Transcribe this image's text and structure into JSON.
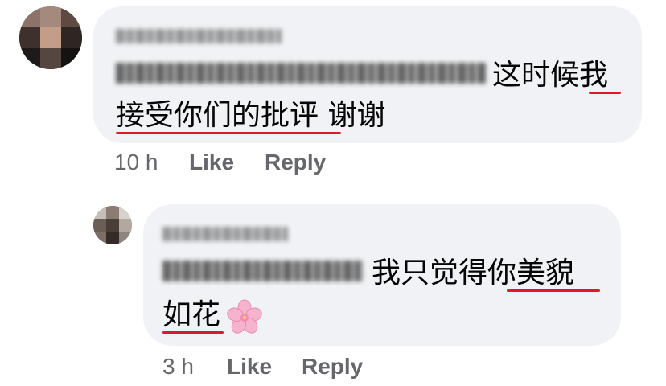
{
  "comments": [
    {
      "text_line1": "这时候我",
      "text_line2": "接受你们的批评 谢谢",
      "time": "10 h",
      "like_label": "Like",
      "reply_label": "Reply"
    },
    {
      "text_line1": "我只觉得你美貌",
      "text_line2": "如花",
      "emoji": "cherry-blossom-icon",
      "time": "3 h",
      "like_label": "Like",
      "reply_label": "Reply"
    }
  ],
  "colors": {
    "bubble": "#f0f2f5",
    "meta": "#65676b",
    "underline": "#e0182b"
  }
}
